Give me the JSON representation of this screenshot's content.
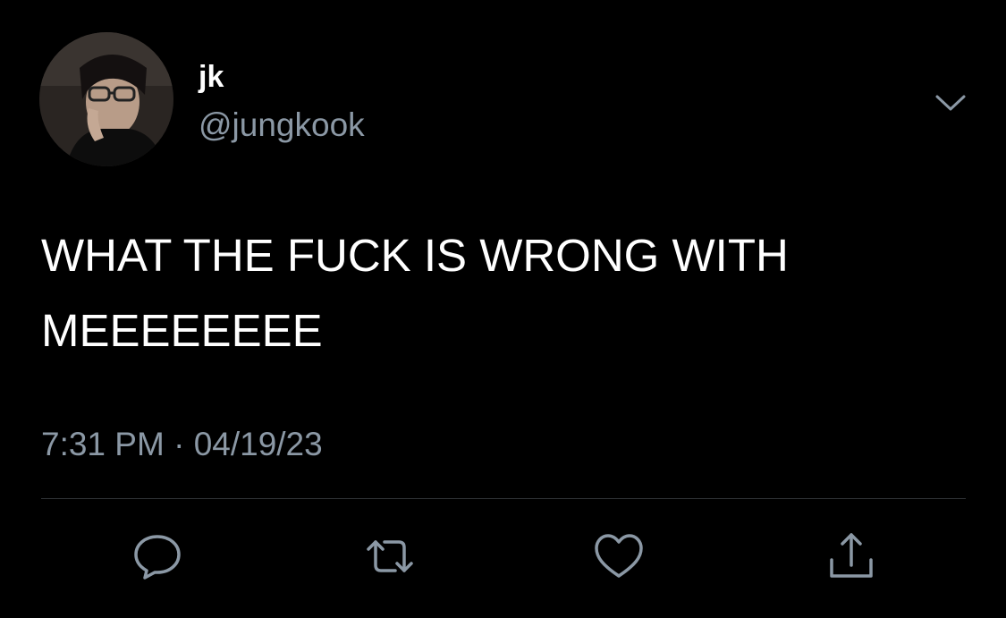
{
  "tweet": {
    "display_name": "jk",
    "handle": "@jungkook",
    "text": "WHAT THE FUCK IS WRONG WITH MEEEEEEEE",
    "time": "7:31 PM",
    "separator": "·",
    "date": "04/19/23"
  },
  "icons": {
    "menu": "chevron-down-icon",
    "reply": "speech-bubble-icon",
    "retweet": "retweet-arrows-icon",
    "like": "heart-icon",
    "share": "share-upload-icon"
  },
  "colors": {
    "background": "#000000",
    "text": "#ffffff",
    "secondary_text": "#8b98a5",
    "divider": "#2f3336",
    "icon": "#8b98a5"
  }
}
